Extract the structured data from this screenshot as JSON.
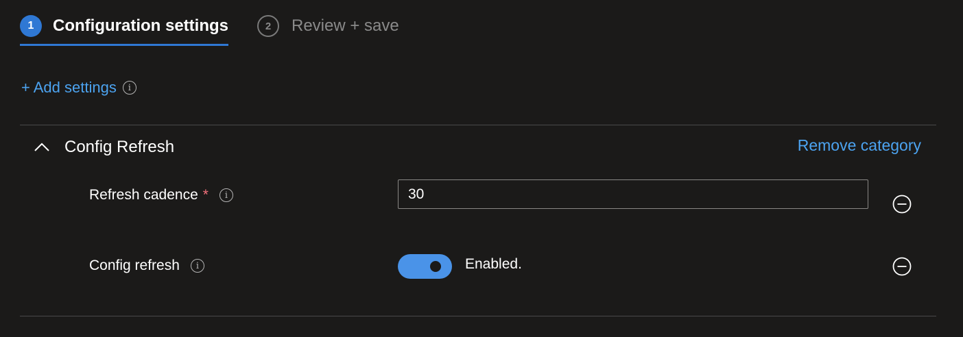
{
  "steps": [
    {
      "number": "1",
      "label": "Configuration settings",
      "active": true
    },
    {
      "number": "2",
      "label": "Review + save",
      "active": false
    }
  ],
  "add_settings": {
    "label": "+ Add settings",
    "info_icon": "info-icon"
  },
  "category": {
    "title": "Config Refresh",
    "collapse_icon": "chevron-up-icon",
    "remove_label": "Remove category"
  },
  "settings": [
    {
      "label": "Refresh cadence",
      "required_mark": "*",
      "value": "30",
      "remove_icon": "remove-circle-icon"
    },
    {
      "label": "Config refresh",
      "toggle_on": true,
      "toggle_text": "Enabled.",
      "remove_icon": "remove-circle-icon"
    }
  ],
  "colors": {
    "accent": "#2f78d4",
    "link": "#4ca3f0",
    "toggle_on": "#4a93e8",
    "required": "#f1707b",
    "background": "#1b1a19"
  }
}
